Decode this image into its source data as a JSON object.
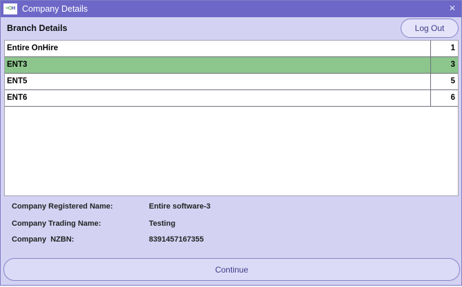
{
  "window": {
    "title": "Company Details",
    "logo_part_a": "≡O",
    "logo_part_b": "H",
    "close_glyph": "✕"
  },
  "header": {
    "title": "Branch Details",
    "logout_label": "Log Out"
  },
  "branches": [
    {
      "name": "Entire OnHire",
      "number": "1",
      "selected": false
    },
    {
      "name": "ENT3",
      "number": "3",
      "selected": true
    },
    {
      "name": "ENT5",
      "number": "5",
      "selected": false
    },
    {
      "name": "ENT6",
      "number": "6",
      "selected": false
    }
  ],
  "details": {
    "registered_label": "Company Registered Name:",
    "registered_value": "Entire software-3",
    "trading_label": "Company Trading Name:",
    "trading_value": "Testing",
    "nzbn_label": "Company  NZBN:",
    "nzbn_value": "8391457167355"
  },
  "footer": {
    "continue_label": "Continue"
  },
  "colors": {
    "titlebar": "#6d68c7",
    "background": "#d3d2f3",
    "selected_row": "#8dc68d"
  }
}
